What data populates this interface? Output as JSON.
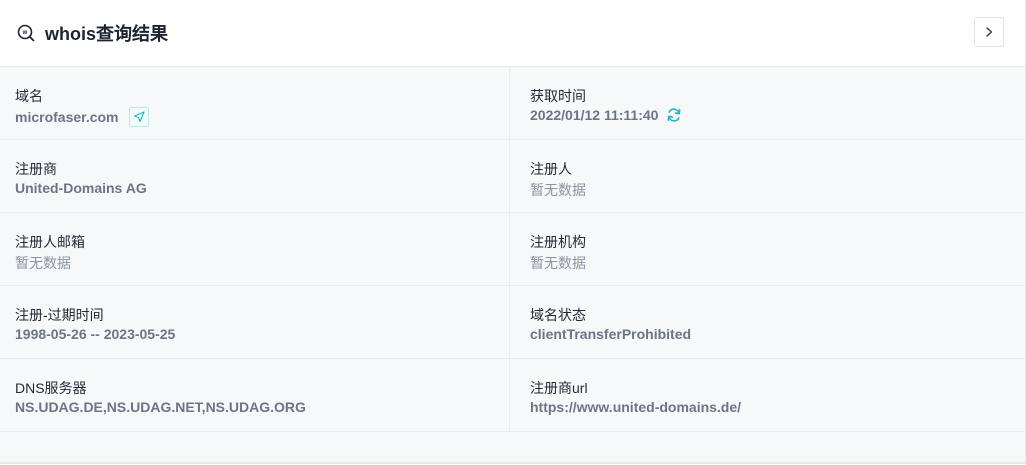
{
  "header": {
    "title": "whois查询结果",
    "icon": "whois-search-icon",
    "nav_icon": "chevron-right-icon"
  },
  "fields": {
    "domain": {
      "label": "域名",
      "value": "microfaser.com"
    },
    "fetch_time": {
      "label": "获取时间",
      "value": "2022/01/12 11:11:40"
    },
    "registrar": {
      "label": "注册商",
      "value": "United-Domains AG"
    },
    "registrant": {
      "label": "注册人",
      "value": "暂无数据"
    },
    "registrant_email": {
      "label": "注册人邮箱",
      "value": "暂无数据"
    },
    "registrant_org": {
      "label": "注册机构",
      "value": "暂无数据"
    },
    "reg_expiry": {
      "label": "注册-过期时间",
      "value": "1998-05-26 -- 2023-05-25"
    },
    "domain_status": {
      "label": "域名状态",
      "value": "clientTransferProhibited"
    },
    "dns": {
      "label": "DNS服务器",
      "value": "NS.UDAG.DE,NS.UDAG.NET,NS.UDAG.ORG"
    },
    "registrar_url": {
      "label": "注册商url",
      "value": "https://www.united-domains.de/"
    }
  },
  "colors": {
    "accent": "#2bb5c4",
    "text_dark": "#222a38",
    "text_muted": "#6b7587",
    "background_grid": "#f7f8fa"
  }
}
